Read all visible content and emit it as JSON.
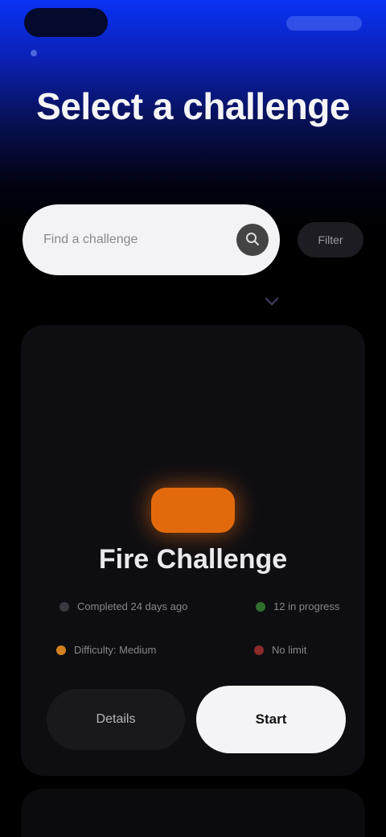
{
  "header": {
    "title": "Select a challenge"
  },
  "search": {
    "placeholder": "Find a challenge",
    "value": "",
    "filter_label": "Filter"
  },
  "card": {
    "title": "Fire Challenge",
    "meta": [
      {
        "label": "Completed 24 days ago",
        "color": "#3a3a42"
      },
      {
        "label": "12 in progress",
        "color": "#2f6e2f"
      },
      {
        "label": "Difficulty: Medium",
        "color": "#d2801e"
      },
      {
        "label": "No limit",
        "color": "#8a2a2a"
      }
    ],
    "secondary_label": "Details",
    "primary_label": "Start"
  },
  "colors": {
    "accent_blue": "#0a32f5",
    "fire_orange": "#e36a0c"
  },
  "icons": {
    "search": "search-icon",
    "hint": "chevron-down-icon"
  }
}
